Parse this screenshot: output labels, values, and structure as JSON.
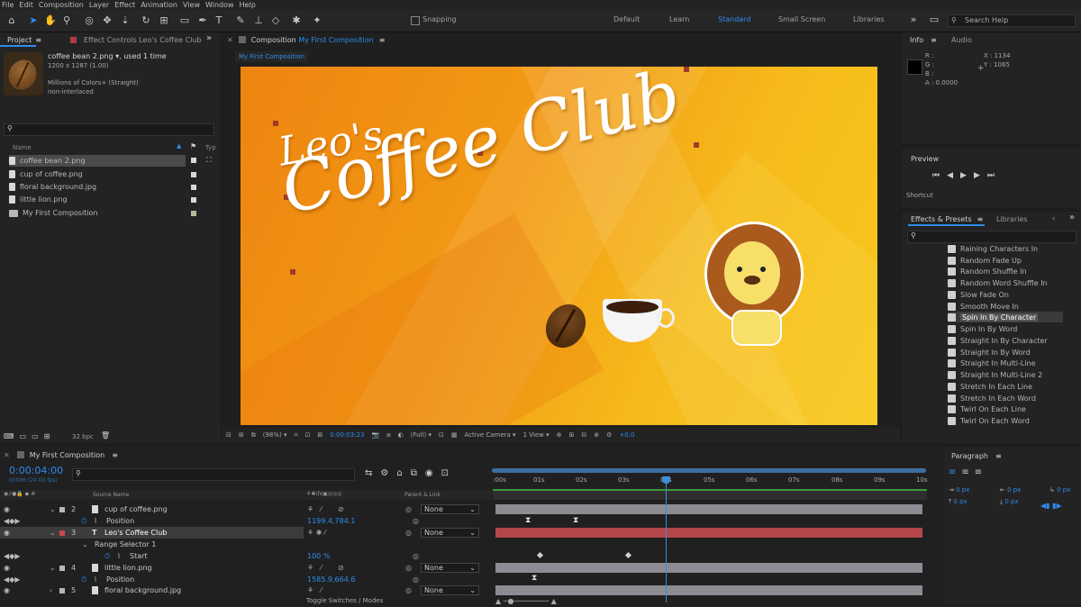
{
  "menu": [
    "File",
    "Edit",
    "Composition",
    "Layer",
    "Effect",
    "Animation",
    "View",
    "Window",
    "Help"
  ],
  "toolbar": {
    "snapping": "Snapping",
    "workspaces": [
      "Default",
      "Learn",
      "Standard",
      "Small Screen",
      "Libraries"
    ],
    "active_workspace": "Standard",
    "search_help": "Search Help"
  },
  "project": {
    "tab_project": "Project",
    "tab_effect_controls": "Effect Controls",
    "effect_controls_target": "Leo's Coffee Club",
    "selected_name": "coffee bean 2.png",
    "used": ", used 1 time",
    "dimensions": "1200 x 1287 (1.00)",
    "colors": "Millions of Colors+ (Straight)",
    "interlace": "non-interlaced",
    "col_name": "Name",
    "col_type": "Typ",
    "bpc": "32 bpc",
    "items": [
      "coffee bean 2.png",
      "cup of coffee.png",
      "floral background.jpg",
      "little lion.png",
      "My First Composition"
    ]
  },
  "composition": {
    "tab_label": "Composition",
    "tab_name": "My First Composition",
    "breadcrumb": "My First Composition",
    "title_line1": "Leo's",
    "title_line2": "Coffee Club",
    "zoom": "(98%)",
    "timecode": "0:00:03:23",
    "resolution": "(Full)",
    "camera": "Active Camera",
    "view": "1 View",
    "exposure": "+0.0",
    "colors": {
      "bg_start": "#f08a12",
      "bg_end": "#f7c61a",
      "text": "#ffffff"
    }
  },
  "info": {
    "tab_info": "Info",
    "tab_audio": "Audio",
    "r": "R :",
    "g": "G :",
    "b": "B :",
    "a": "A :",
    "a_val": "0.0000",
    "x": "X : 1134",
    "y": "Y : 1065"
  },
  "preview": {
    "title": "Preview",
    "shortcut": "Shortcut"
  },
  "effects": {
    "tab": "Effects & Presets",
    "tab_libraries": "Libraries",
    "items": [
      "Raining Characters In",
      "Random Fade Up",
      "Random Shuffle In",
      "Random Word Shuffle In",
      "Slow Fade On",
      "Smooth Move In",
      "Spin In By Character",
      "Spin In By Word",
      "Straight In By Character",
      "Straight In By Word",
      "Straight In Multi-Line",
      "Straight In Multi-Line 2",
      "Stretch In Each Line",
      "Stretch In Each Word",
      "Twirl On Each Line",
      "Twirl On Each Word"
    ],
    "selected": "Spin In By Character"
  },
  "paragraph": {
    "title": "Paragraph",
    "fields": [
      "0 px",
      "0 px",
      "0 px",
      "0 px",
      "0 px"
    ]
  },
  "timeline": {
    "tab": "My First Composition",
    "timecode": "0:00:04:00",
    "fps": "00096 (24.00 fps)",
    "col_source": "Source Name",
    "col_parent": "Parent & Link",
    "toggle": "Toggle Switches / Modes",
    "ruler": [
      ":00s",
      "01s",
      "02s",
      "03s",
      "04s",
      "05s",
      "06s",
      "07s",
      "08s",
      "09s",
      "10s"
    ],
    "layers": [
      {
        "num": "2",
        "name": "cup of coffee.png",
        "parent": "None"
      },
      {
        "prop": "Position",
        "value": "1199.4,784.1"
      },
      {
        "num": "3",
        "name": "Leo's Coffee Club",
        "parent": "None"
      },
      {
        "prop": "Range Selector 1"
      },
      {
        "prop": "Start",
        "value": "100 %"
      },
      {
        "num": "4",
        "name": "little lion.png",
        "parent": "None"
      },
      {
        "prop": "Position",
        "value": "1585.9,664.6"
      },
      {
        "num": "5",
        "name": "floral background.jpg",
        "parent": "None"
      }
    ],
    "colors": {
      "grey_bar": "#8c8c93",
      "red_bar": "#b4474a",
      "green_bar": "#3a9b3e",
      "playhead": "#3d8fd4"
    }
  }
}
